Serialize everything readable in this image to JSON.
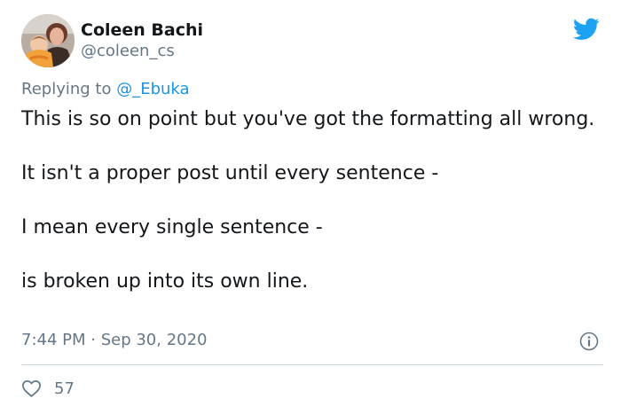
{
  "author": {
    "display_name": "Coleen Bachi",
    "handle": "@coleen_cs",
    "avatar_icon": "profile-photo"
  },
  "reply": {
    "prefix": "Replying to",
    "mention": "@_Ebuka"
  },
  "body": {
    "lines": [
      "This is so on point but you've got the formatting all wrong.",
      "It isn't a proper post until every sentence -",
      "I mean every single sentence -",
      "is broken up into its own line."
    ]
  },
  "meta": {
    "timestamp": "7:44 PM · Sep 30, 2020",
    "likes": "57"
  },
  "icons": {
    "brand": "twitter-bird-icon",
    "info": "info-icon",
    "like": "heart-icon"
  },
  "colors": {
    "brand_blue": "#1da1f2",
    "link_blue": "#1b95e0",
    "text_primary": "#14171a",
    "text_secondary": "#657786",
    "divider": "#ccd6dd"
  }
}
